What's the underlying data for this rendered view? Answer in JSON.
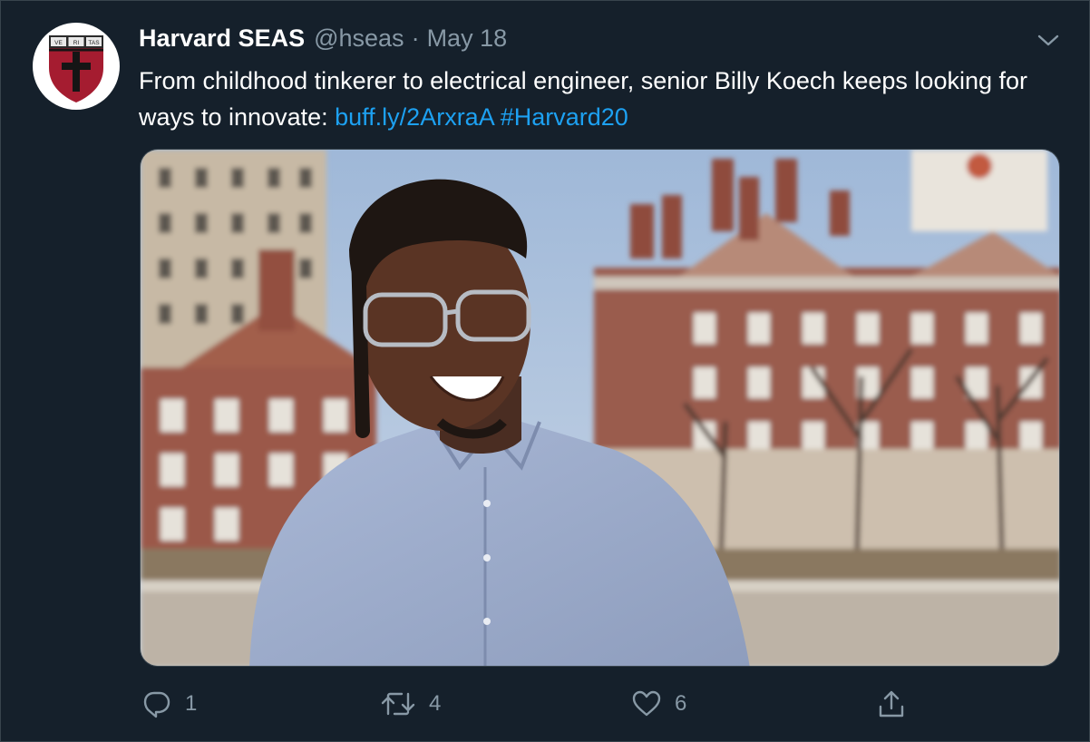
{
  "tweet": {
    "author_name": "Harvard SEAS",
    "handle": "@hseas",
    "separator": "·",
    "date": "May 18",
    "text_before": "From childhood tinkerer to electrical engineer, senior Billy Koech keeps looking for ways to innovate: ",
    "link": "buff.ly/2ArxraA",
    "hashtag": "#Harvard20",
    "replies": "1",
    "retweets": "4",
    "likes": "6"
  },
  "avatar": {
    "shield_banner": [
      "VE",
      "RI",
      "TAS"
    ]
  },
  "colors": {
    "background": "#15202b",
    "secondary_text": "#8899a6",
    "link": "#1da1f2",
    "shield_red": "#a51c30"
  },
  "icons": {
    "reply": "reply-icon",
    "retweet": "retweet-icon",
    "like": "heart-icon",
    "share": "share-icon",
    "menu": "chevron-down-icon"
  }
}
